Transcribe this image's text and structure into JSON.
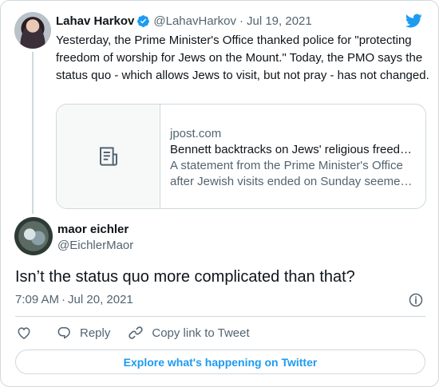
{
  "colors": {
    "accent": "#1d9bf0",
    "text_primary": "#0f1419",
    "text_secondary": "#536471",
    "border": "#cfd9de"
  },
  "parent_tweet": {
    "author_name": "Lahav Harkov",
    "handle": "@LahavHarkov",
    "separator": "·",
    "date": "Jul 19, 2021",
    "text": "Yesterday, the Prime Minister's Office thanked police for \"protecting freedom of worship for Jews on the Mount.\" Today, the PMO says the status quo - which allows Jews to visit, but not pray - has not changed.",
    "verified_icon": "verified-badge-icon",
    "link_card": {
      "thumbnail_icon": "article-icon",
      "domain": "jpost.com",
      "title": "Bennett backtracks on Jews' religious freed…",
      "description_line1": "A statement from the Prime Minister's Office",
      "description_line2": "after Jewish visits ended on Sunday seeme…"
    }
  },
  "reply_tweet": {
    "author_name": "maor eichler",
    "handle": "@EichlerMaor",
    "text": "Isn’t the status quo more complicated than that?",
    "time": "7:09 AM",
    "separator": "·",
    "date": "Jul 20, 2021"
  },
  "actions": {
    "like_icon": "heart-icon",
    "reply_label": "Reply",
    "reply_icon": "reply-bubble-icon",
    "copy_label": "Copy link to Tweet",
    "copy_icon": "link-icon"
  },
  "explore_button_label": "Explore what's happening on Twitter",
  "logo_icon": "twitter-bird-icon"
}
